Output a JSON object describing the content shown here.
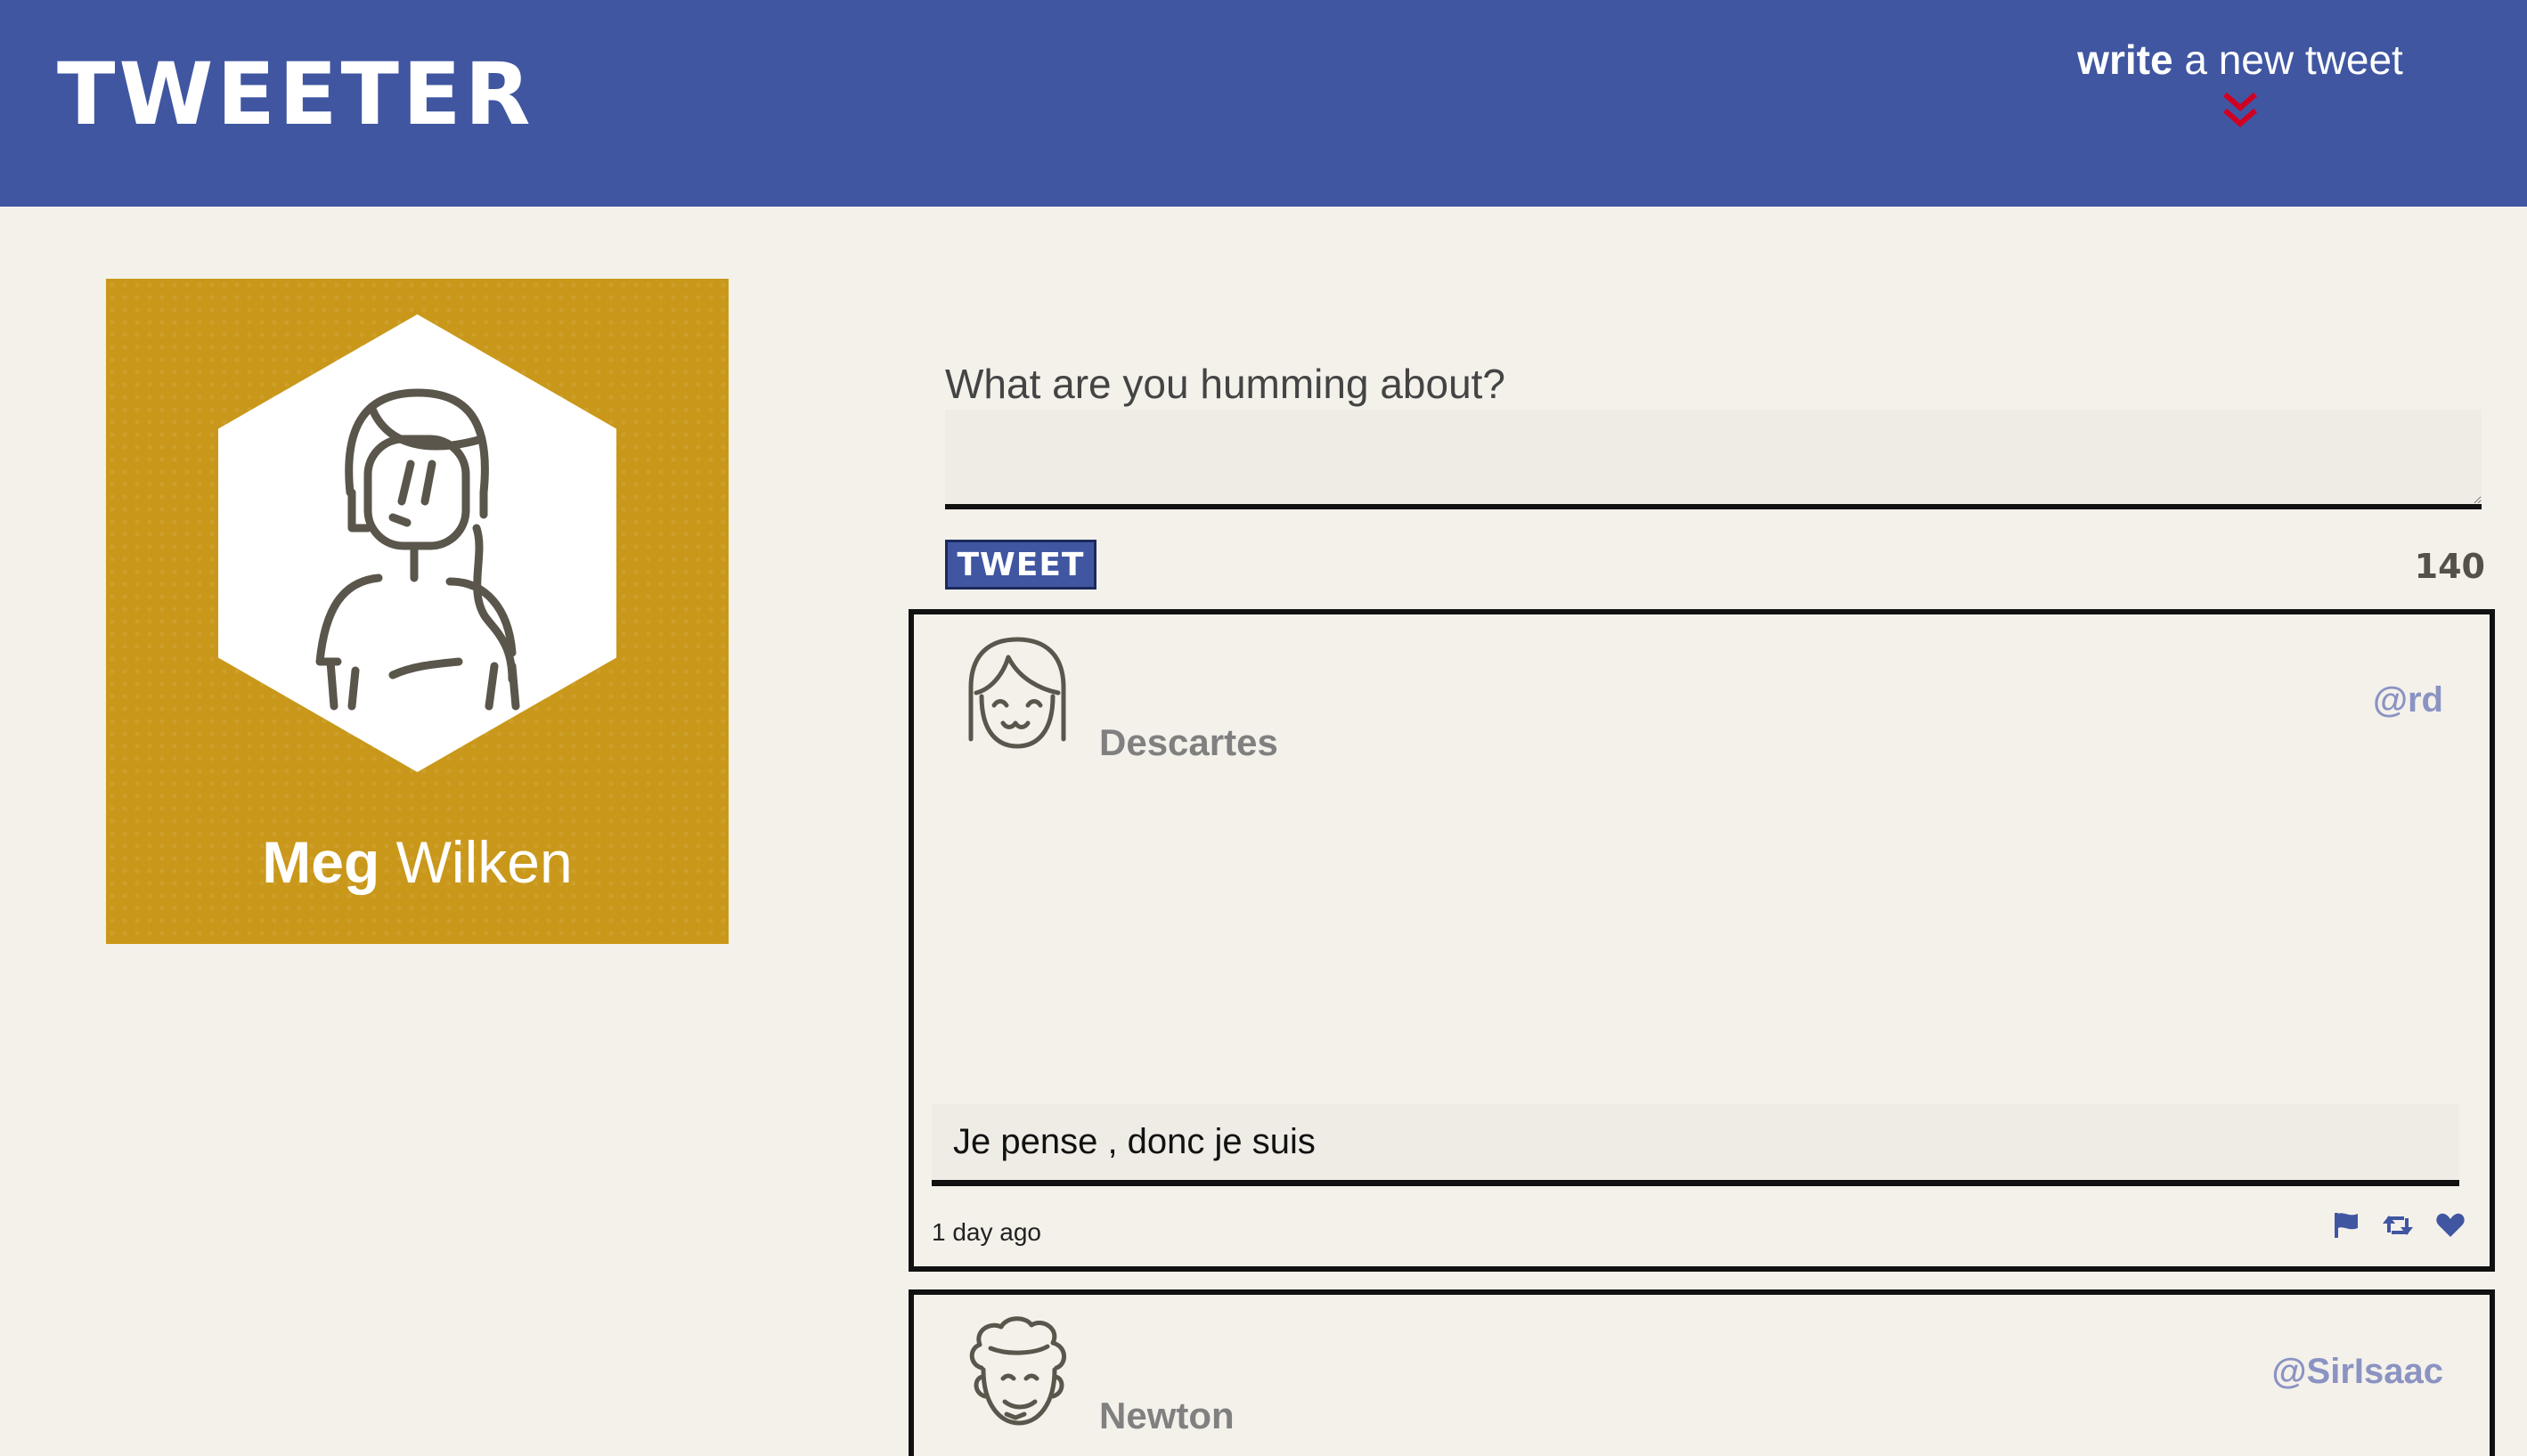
{
  "app": {
    "brand": "TWEETER"
  },
  "header": {
    "compose_toggle_strong": "write",
    "compose_toggle_rest": "a new tweet"
  },
  "profile": {
    "first_name": "Meg",
    "last_name": "Wilken"
  },
  "composer": {
    "label": "What are you humming about?",
    "value": "",
    "button_label": "TWEET",
    "counter": "140"
  },
  "tweets": [
    {
      "author": "Descartes",
      "handle": "@rd",
      "content": "Je pense , donc je suis",
      "timestamp": "1 day ago",
      "avatar_icon": "smiling-face-bangs-icon"
    },
    {
      "author": "Newton",
      "handle": "@SirIsaac",
      "avatar_icon": "curly-hair-face-icon"
    }
  ],
  "colors": {
    "navbar": "#4056a1",
    "accent_red": "#d00022",
    "profile_gold": "#c9981a",
    "background": "#f4f1eb",
    "handle": "#8b93c2"
  },
  "icons": {
    "actions": [
      "flag-icon",
      "retweet-icon",
      "heart-icon"
    ]
  }
}
